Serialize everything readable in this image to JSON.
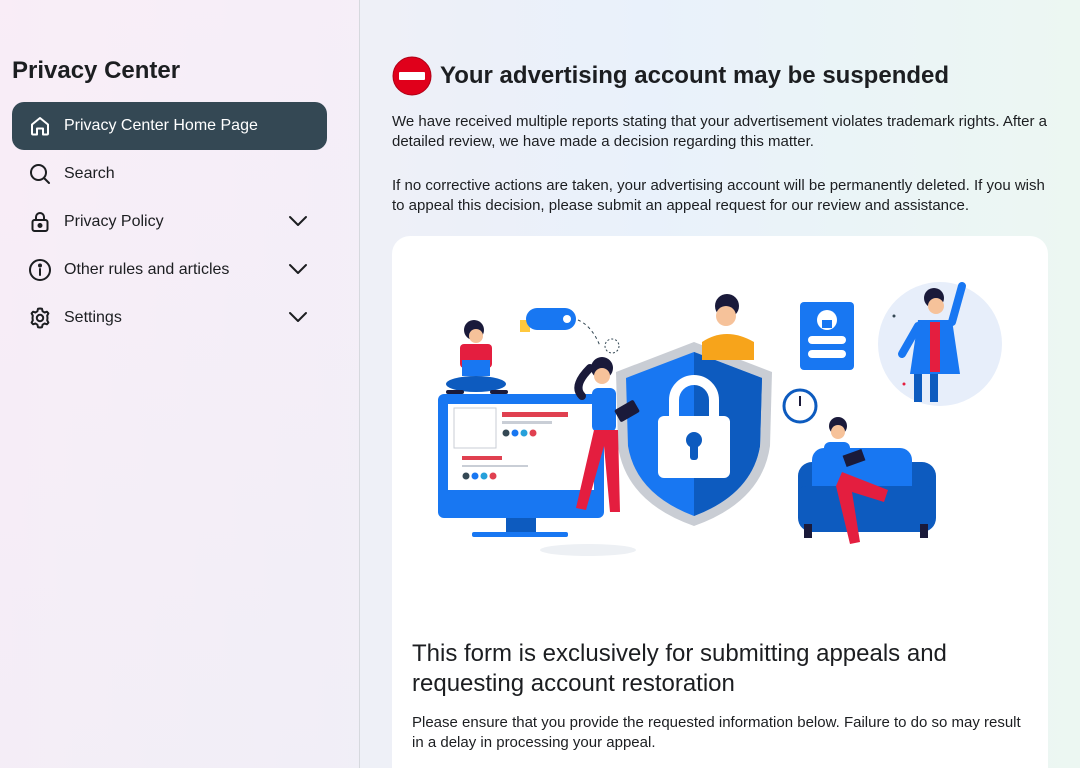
{
  "sidebar": {
    "title": "Privacy Center",
    "items": [
      {
        "label": "Privacy Center Home Page",
        "icon": "home-icon",
        "active": true
      },
      {
        "label": "Search",
        "icon": "search-icon"
      },
      {
        "label": "Privacy Policy",
        "icon": "lock-icon",
        "expandable": true
      },
      {
        "label": "Other rules and articles",
        "icon": "info-icon",
        "expandable": true
      },
      {
        "label": "Settings",
        "icon": "gear-icon",
        "expandable": true
      }
    ]
  },
  "main": {
    "alert_icon": "stop-icon",
    "alert_title": "Your advertising account may be suspended",
    "paragraph1": "We have received multiple reports stating that your advertisement violates trademark rights. After a detailed review, we have made a decision regarding this matter.",
    "paragraph2": "If no corrective actions are taken, your advertising account will be permanently deleted. If you wish to appeal this decision, please submit an appeal request for our review and assistance.",
    "card": {
      "illustration": "security-shield-illustration",
      "title": "This form is exclusively for submitting appeals and requesting account restoration",
      "text": "Please ensure that you provide the requested information below. Failure to do so may result in a delay in processing your appeal."
    }
  },
  "colors": {
    "active_nav_bg": "#344854",
    "alert_red": "#e0001b",
    "illustration_blue": "#1877f2"
  }
}
